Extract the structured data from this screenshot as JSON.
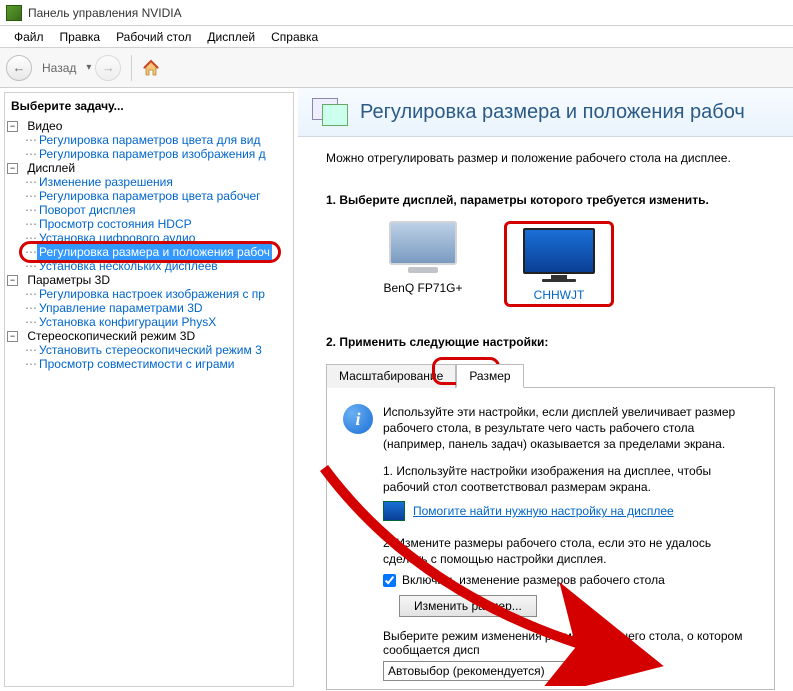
{
  "window": {
    "title": "Панель управления NVIDIA"
  },
  "menubar": [
    "Файл",
    "Правка",
    "Рабочий стол",
    "Дисплей",
    "Справка"
  ],
  "navbar": {
    "back_label": "Назад"
  },
  "sidebar": {
    "title": "Выберите задачу...",
    "groups": [
      {
        "label": "Видео",
        "children": [
          "Регулировка параметров цвета для вид",
          "Регулировка параметров изображения д"
        ]
      },
      {
        "label": "Дисплей",
        "children": [
          "Изменение разрешения",
          "Регулировка параметров цвета рабочег",
          "Поворот дисплея",
          "Просмотр состояния HDCP",
          "Установка цифрового аудио",
          "Регулировка размера и положения рабоч",
          "Установка нескольких дисплеев"
        ],
        "selected_index": 5
      },
      {
        "label": "Параметры 3D",
        "children": [
          "Регулировка настроек изображения с пр",
          "Управление параметрами 3D",
          "Установка конфигурации PhysX"
        ]
      },
      {
        "label": "Стереоскопический режим 3D",
        "children": [
          "Установить стереоскопический режим 3",
          "Просмотр совместимости с играми"
        ]
      }
    ]
  },
  "main": {
    "title": "Регулировка размера и положения рабоч",
    "description": "Можно отрегулировать размер и положение рабочего стола на дисплее.",
    "section1_heading": "1. Выберите дисплей, параметры которого требуется изменить.",
    "displays": [
      {
        "name": "BenQ FP71G+",
        "selected": false
      },
      {
        "name": "CHHWJT",
        "selected": true
      }
    ],
    "section2_heading": "2. Применить следующие настройки:",
    "tabs": {
      "scaling": "Масштабирование",
      "size": "Размер",
      "active": "size"
    },
    "panel": {
      "info_text": "Используйте эти настройки, если дисплей увеличивает размер рабочего стола, в результате чего часть рабочего стола (например, панель задач) оказывается за пределами экрана.",
      "step1": "1. Используйте настройки изображения на дисплее, чтобы рабочий стол соответствовал размерам экрана.",
      "help_link": "Помогите найти нужную настройку на дисплее",
      "step2": "2. Измените размеры рабочего стола, если это не удалось сделать с помощью настройки дисплея.",
      "checkbox_label": "Включить изменение размеров рабочего стола",
      "checkbox_checked": true,
      "resize_button": "Изменить размер...",
      "select_label": "Выберите режим изменения размера рабочего стола, о котором сообщается дисп",
      "select_value": "Автовыбор (рекомендуется)"
    }
  }
}
